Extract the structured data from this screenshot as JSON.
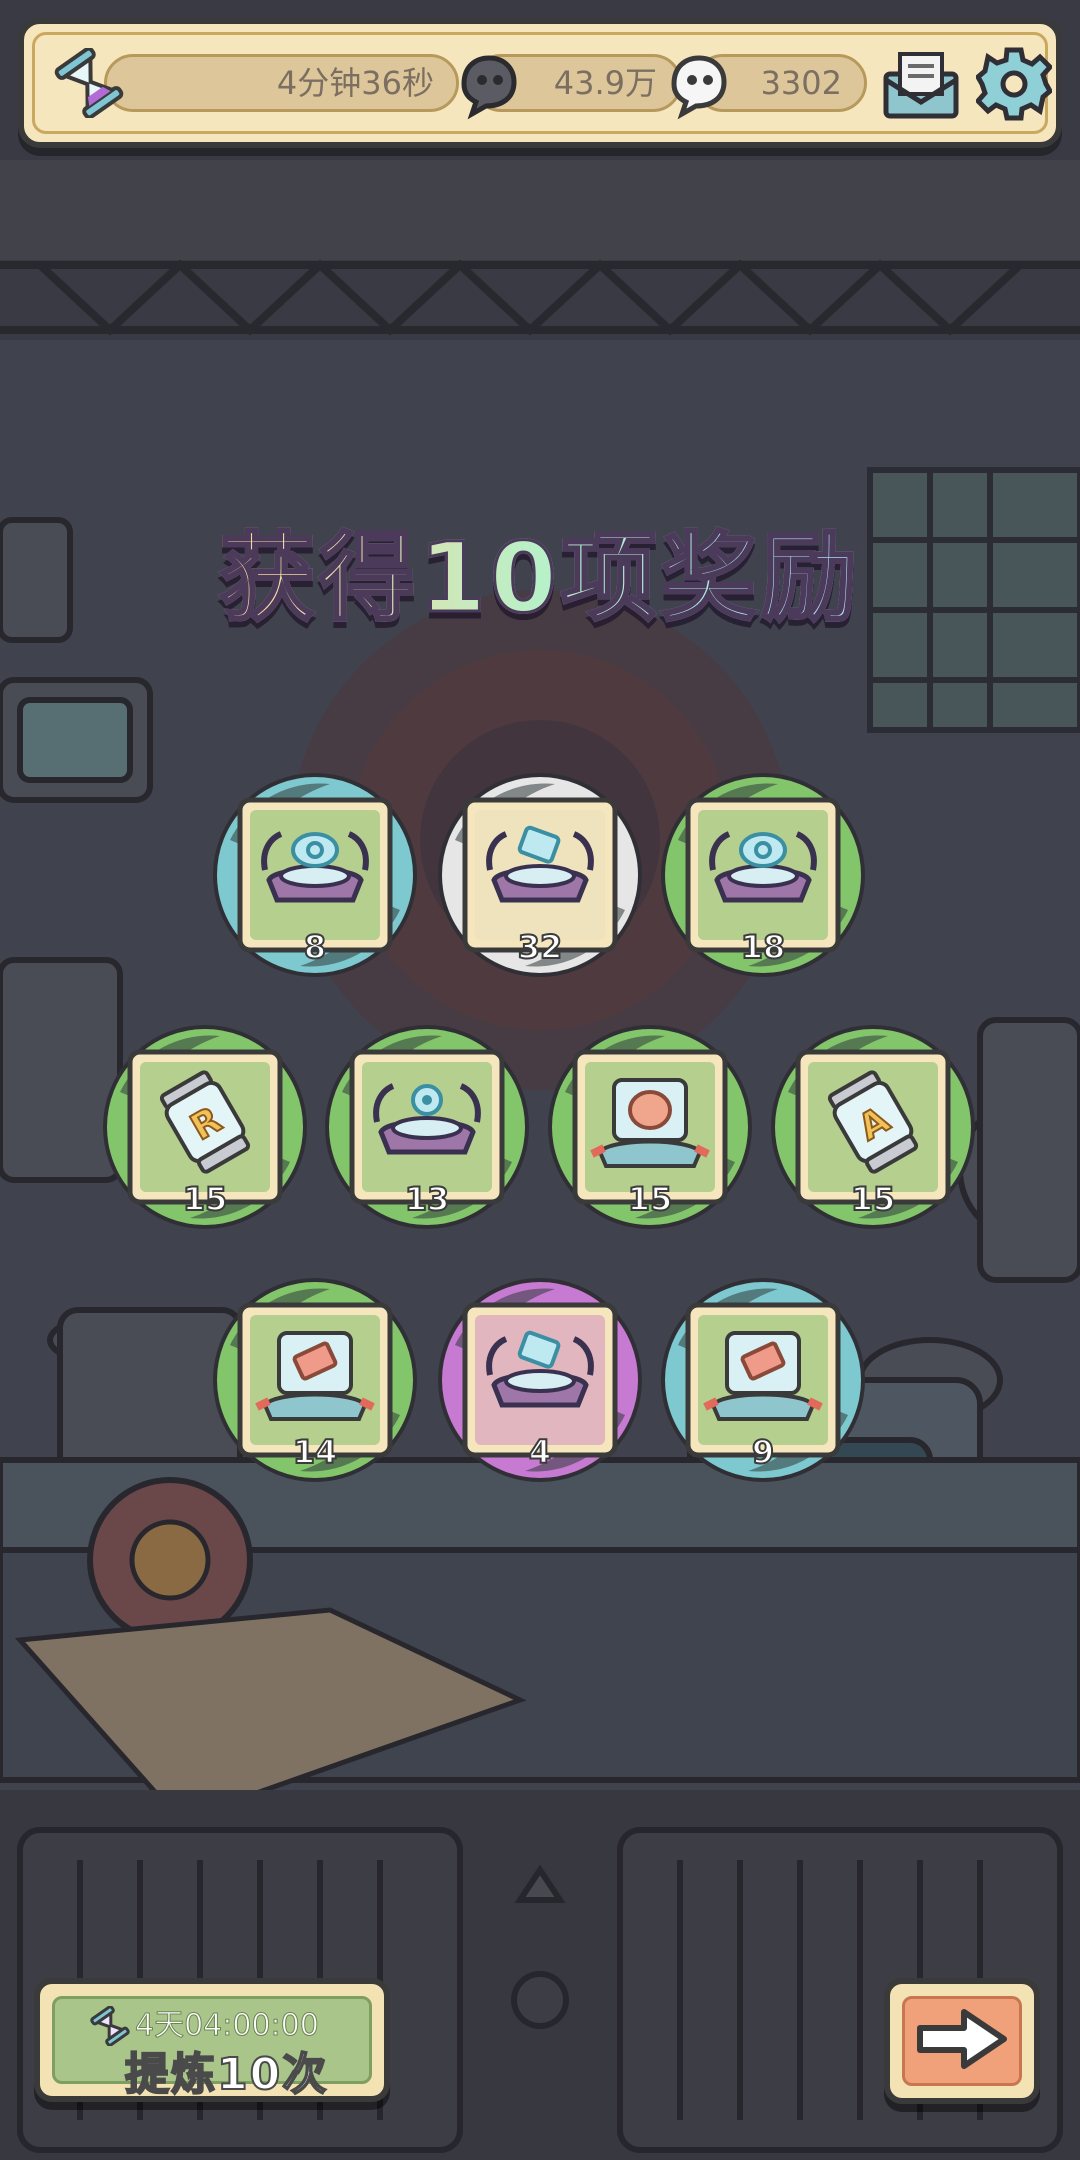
{
  "hud": {
    "timer": "4分钟36秒",
    "dark_souls": "43.9万",
    "light_souls": "3302",
    "icons": [
      "hourglass-icon",
      "dark-ghost-icon",
      "light-ghost-icon",
      "mail-icon",
      "gear-icon"
    ]
  },
  "title": "获得10项奖励",
  "rewards": [
    {
      "count": "8",
      "rarity": "blue",
      "item": "robot-holo-disc"
    },
    {
      "count": "32",
      "rarity": "white",
      "item": "robot-holo-card"
    },
    {
      "count": "18",
      "rarity": "green",
      "item": "robot-holo-disc"
    },
    {
      "count": "15",
      "rarity": "green",
      "item": "capsule-r"
    },
    {
      "count": "13",
      "rarity": "green",
      "item": "robot-holo-gear"
    },
    {
      "count": "15",
      "rarity": "green",
      "item": "tank-brain"
    },
    {
      "count": "15",
      "rarity": "green",
      "item": "capsule-a"
    },
    {
      "count": "14",
      "rarity": "green",
      "item": "tank-card"
    },
    {
      "count": "4",
      "rarity": "purple",
      "item": "robot-holo-card"
    },
    {
      "count": "9",
      "rarity": "blue",
      "item": "tank-card"
    }
  ],
  "colors": {
    "blue": "#7ec9cf",
    "white": "#e6e6e6",
    "green": "#83c56a",
    "purple": "#c77ad1",
    "card_green": "#b4cf8e",
    "card_white": "#efe3bd",
    "card_pink": "#e2b6bf"
  },
  "bottom": {
    "refine_timer": "4天04:00:00",
    "refine_label": "提炼10次",
    "next_icon": "arrow-right-icon"
  }
}
